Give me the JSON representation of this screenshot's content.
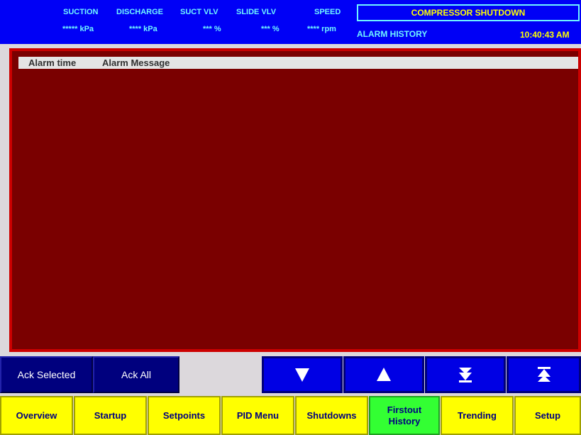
{
  "header": {
    "labels": [
      "SUCTION",
      "DISCHARGE",
      "SUCT VLV",
      "SLIDE VLV",
      "SPEED"
    ],
    "values": [
      "***** kPa",
      "**** kPa",
      "*** %",
      "*** %",
      "**** rpm"
    ],
    "status": "COMPRESSOR SHUTDOWN",
    "screen_title": "ALARM HISTORY",
    "time": "10:40:43 AM"
  },
  "alarm_table": {
    "columns": [
      "Alarm time",
      "Alarm Message"
    ],
    "rows": []
  },
  "actions": {
    "ack_selected": "Ack Selected",
    "ack_all": "Ack All"
  },
  "scroll_buttons": [
    {
      "icon": "arrow-down-icon"
    },
    {
      "icon": "arrow-up-icon"
    },
    {
      "icon": "page-down-icon"
    },
    {
      "icon": "page-up-icon"
    }
  ],
  "nav": [
    {
      "label": "Overview",
      "active": false
    },
    {
      "label": "Startup",
      "active": false
    },
    {
      "label": "Setpoints",
      "active": false
    },
    {
      "label": "PID Menu",
      "active": false
    },
    {
      "label": "Shutdowns",
      "active": false
    },
    {
      "label": "Firstout History",
      "active": true
    },
    {
      "label": "Trending",
      "active": false
    },
    {
      "label": "Setup",
      "active": false
    }
  ],
  "colors": {
    "header_bg": "#0000f6",
    "header_text": "#6ff4ff",
    "status_text": "#ffff00",
    "panel_bg": "#7a0000",
    "nav_bg": "#ffff00",
    "nav_active_bg": "#33ff33"
  }
}
